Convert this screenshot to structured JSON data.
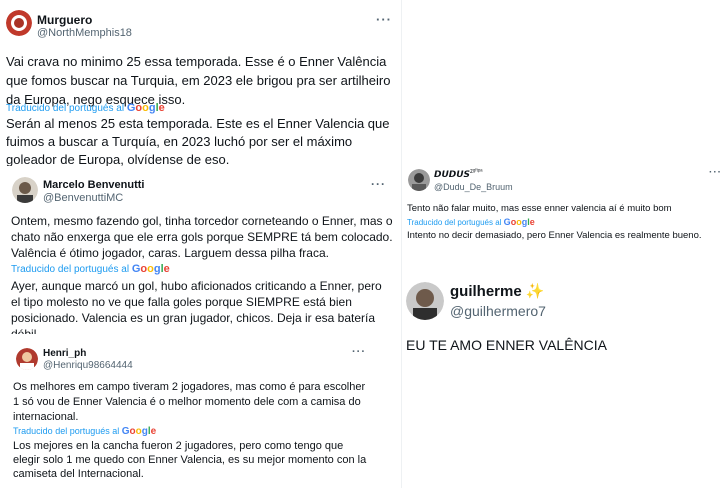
{
  "translated_label": "Traducido del portugués al",
  "google_word": "Google",
  "tweets": [
    {
      "name": "Murguero",
      "handle": "@NorthMemphis18",
      "more": "···",
      "text": "Vai crava no minimo 25 essa temporada. Esse é o Enner Valência que fomos buscar na Turquia, em 2023 ele brigou pra ser artilheiro da Europa, nego esquece isso.",
      "translation": "Serán al menos 25 esta temporada. Este es el Enner Valencia que fuimos a buscar a Turquía, en 2023 luchó por ser el máximo goleador de Europa, olvídense de eso."
    },
    {
      "name": "Marcelo Benvenutti",
      "handle": "@BenvenuttiMC",
      "more": "···",
      "text": "Ontem, mesmo fazendo gol, tinha torcedor corneteando o Enner, mas o chato não enxerga que ele erra gols porque SEMPRE tá bem colocado. Valência é ótimo jogador, caras. Larguem dessa pilha fraca.",
      "translation": "Ayer, aunque marcó un gol, hubo aficionados criticando a Enner, pero el tipo molesto no ve que falla goles porque SIEMPRE está bien posicionado. Valencia es un gran jugador, chicos. Deja ir esa batería débil."
    },
    {
      "name": "Henri_ph",
      "handle": "@Henriqu98664444",
      "more": "···",
      "text": "Os melhores em campo tiveram 2 jogadores, mas como é para escolher 1 só vou de Enner Valencia é o melhor momento dele com a camisa do internacional.",
      "translation": "Los mejores en la cancha fueron 2 jugadores, pero como tengo que elegir solo 1 me quedo con Enner Valencia, es su mejor momento con la camiseta del Internacional."
    },
    {
      "name": "𝘿𝙐𝘿𝙐𝙎",
      "name_sup": "zᵍᶠᵗᵖᵃ",
      "handle": "@Dudu_De_Bruum",
      "more": "···",
      "text": "Tento não falar muito, mas esse enner valencia aí é muito bom",
      "translation": "Intento no decir demasiado, pero Enner Valencia es realmente bueno."
    },
    {
      "name": "guilherme",
      "name_emoji": "✨",
      "handle": "@guilhermero7",
      "text": "EU TE AMO ENNER VALÊNCIA"
    }
  ]
}
